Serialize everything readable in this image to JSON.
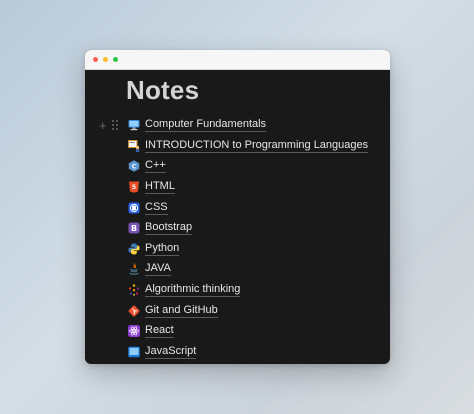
{
  "window": {
    "controls": [
      "close",
      "minimize",
      "zoom"
    ]
  },
  "page": {
    "title": "Notes"
  },
  "items": [
    {
      "label": "Computer Fundamentals",
      "icon": "desktop-computer-icon"
    },
    {
      "label": "INTRODUCTION to Programming Languages",
      "icon": "teacher-board-icon"
    },
    {
      "label": "C++",
      "icon": "cpp-logo-icon"
    },
    {
      "label": "HTML",
      "icon": "html5-logo-icon"
    },
    {
      "label": "CSS",
      "icon": "css3-logo-icon"
    },
    {
      "label": "Bootstrap",
      "icon": "bootstrap-logo-icon"
    },
    {
      "label": "Python",
      "icon": "python-logo-icon"
    },
    {
      "label": "JAVA",
      "icon": "java-logo-icon"
    },
    {
      "label": "Algorithmic thinking",
      "icon": "dots-cluster-icon"
    },
    {
      "label": "Git and GitHub",
      "icon": "git-logo-icon"
    },
    {
      "label": "React",
      "icon": "react-logo-icon"
    },
    {
      "label": "JavaScript",
      "icon": "monitor-icon"
    }
  ],
  "colors": {
    "window_bg": "#191919",
    "title_text": "#d4d4d4",
    "item_text": "#e6e6e6"
  }
}
